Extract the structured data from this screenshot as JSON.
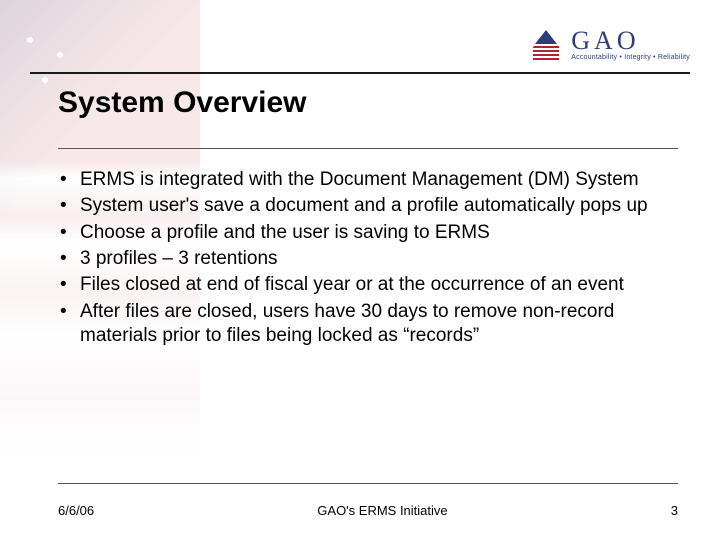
{
  "logo": {
    "name": "GAO",
    "tagline": "Accountability • Integrity • Reliability"
  },
  "title": "System Overview",
  "bullets": [
    "ERMS is integrated with the Document Management (DM) System",
    "System user's save a document and a profile automatically pops up",
    "Choose a profile and the user is saving to ERMS",
    "3 profiles – 3 retentions",
    "Files closed at end of fiscal year or at the occurrence of an event",
    "After files are closed, users have 30 days to remove non-record materials prior to files being locked as “records”"
  ],
  "footer": {
    "date": "6/6/06",
    "center": "GAO's ERMS Initiative",
    "page": "3"
  }
}
